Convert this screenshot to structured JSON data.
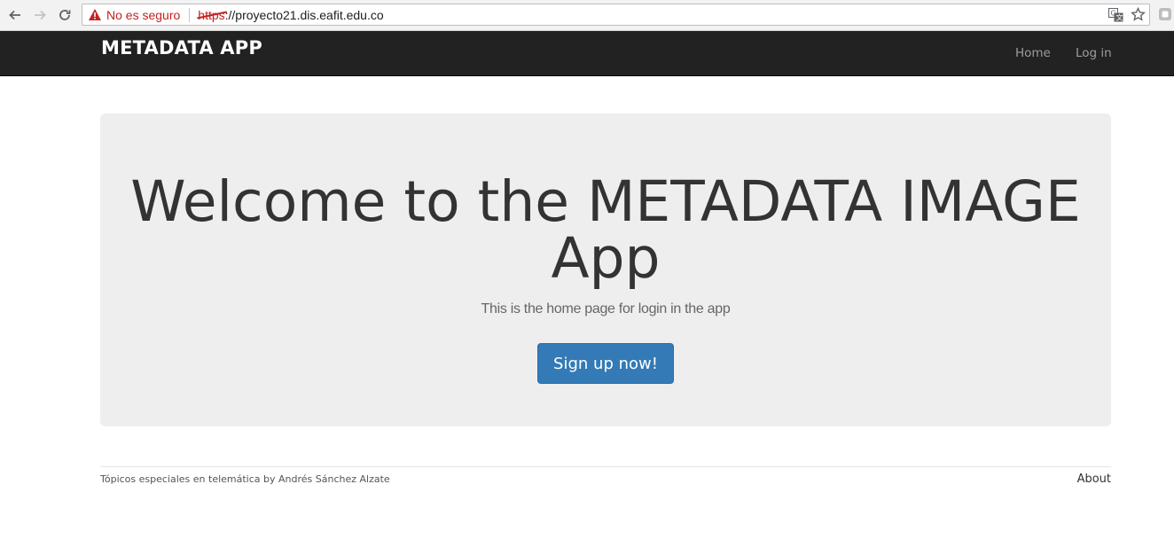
{
  "browser": {
    "security_label": "No es seguro",
    "url_scheme": "https",
    "url_rest": "://proyecto21.dis.eafit.edu.co",
    "icons": [
      "back-icon",
      "forward-icon",
      "reload-icon",
      "warning-icon",
      "translate-icon",
      "star-icon",
      "extension-icon"
    ],
    "security_color": "#c5221f"
  },
  "navbar": {
    "brand": "METADATA APP",
    "links": [
      {
        "label": "Home"
      },
      {
        "label": "Log in"
      }
    ],
    "background": "#222222"
  },
  "hero": {
    "title": "Welcome to the METADATA IMAGE App",
    "lead": "This is the home page for login in the app",
    "button_label": "Sign up now!",
    "background": "#eeeeee",
    "button_color": "#337ab7"
  },
  "footer": {
    "credit": "Tópicos especiales en telemática by Andrés Sánchez Alzate",
    "about": "About"
  }
}
